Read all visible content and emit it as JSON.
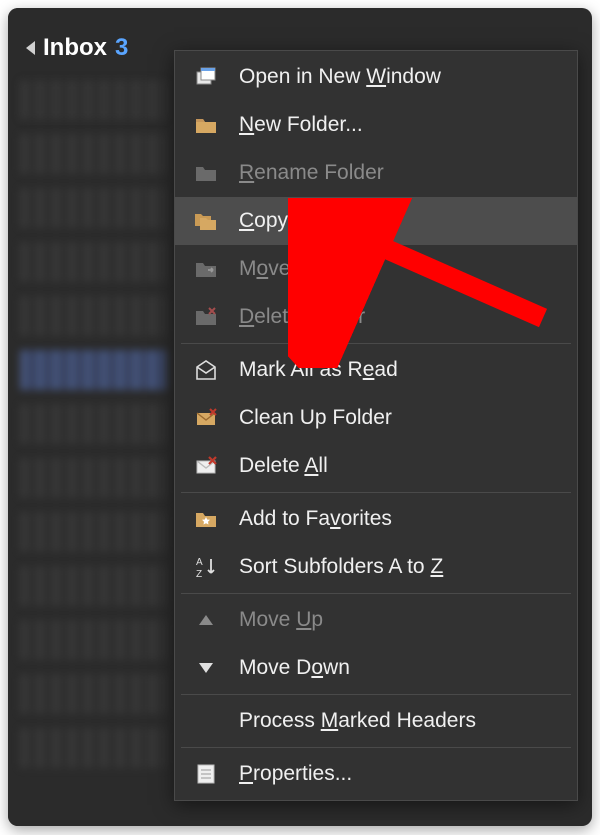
{
  "sidebar": {
    "expand_state": "expanded",
    "inbox_label": "Inbox",
    "unread_count": "3"
  },
  "menu": {
    "open_new_window": "Open in New Window",
    "new_folder": "New Folder...",
    "rename_folder": "Rename Folder",
    "copy_folder": "Copy Folder",
    "move_folder": "Move Folder",
    "delete_folder": "Delete Folder",
    "mark_all_read": "Mark All as Read",
    "clean_up": "Clean Up Folder",
    "delete_all": "Delete All",
    "add_favorites": "Add to Favorites",
    "sort_az": "Sort Subfolders A to Z",
    "move_up": "Move Up",
    "move_down": "Move Down",
    "process_marked": "Process Marked Headers",
    "properties": "Properties..."
  },
  "colors": {
    "bg": "#2b2b2b",
    "menu_bg": "#323232",
    "hover": "#4d4d4d",
    "text": "#f0f0f0",
    "disabled": "#8a8a8a",
    "accent_blue": "#5aa5ff",
    "arrow_red": "#ff0000"
  }
}
